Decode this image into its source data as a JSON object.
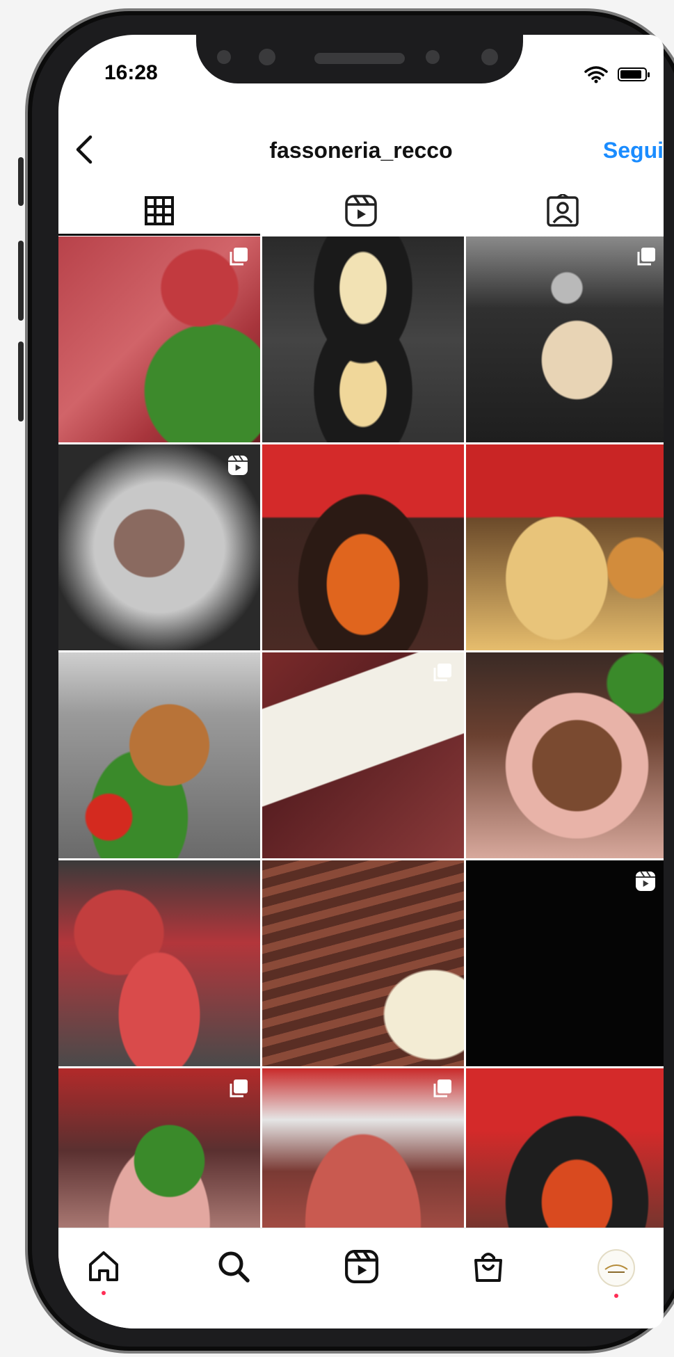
{
  "status_bar": {
    "time": "16:28"
  },
  "header": {
    "username": "fassoneria_recco",
    "follow_label": "Segui"
  },
  "tabs": [
    {
      "name": "posts",
      "icon": "grid-icon",
      "active": true
    },
    {
      "name": "reels",
      "icon": "reels-icon",
      "active": false
    },
    {
      "name": "tagged",
      "icon": "tagged-person-icon",
      "active": false
    }
  ],
  "grid": [
    {
      "subject": "raw beef tartare with arugula",
      "badge": "multi-post-icon"
    },
    {
      "subject": "spaghetti plated in black bowl",
      "badge": ""
    },
    {
      "subject": "sauce poured over meat",
      "badge": "multi-post-icon"
    },
    {
      "subject": "burger patty in pan",
      "badge": "reel-icon"
    },
    {
      "subject": "pasta with ragù in pan",
      "badge": ""
    },
    {
      "subject": "meat with potatoes and sauce",
      "badge": ""
    },
    {
      "subject": "grilled meat with tomatoes",
      "badge": ""
    },
    {
      "subject": "packaged meat",
      "badge": "multi-post-icon"
    },
    {
      "subject": "sliced roast beef",
      "badge": ""
    },
    {
      "subject": "raw hamburger patties",
      "badge": ""
    },
    {
      "subject": "grilled ribs platter",
      "badge": ""
    },
    {
      "subject": "black reel",
      "badge": "reel-icon"
    },
    {
      "subject": "cured meats with arugula",
      "badge": "multi-post-icon"
    },
    {
      "subject": "raw beef slices",
      "badge": "multi-post-icon"
    },
    {
      "subject": "pasta dish in restaurant",
      "badge": ""
    }
  ],
  "bottom_nav": [
    {
      "name": "home",
      "icon": "home-icon",
      "notification_dot": true
    },
    {
      "name": "search",
      "icon": "search-icon",
      "notification_dot": false
    },
    {
      "name": "reels",
      "icon": "reels-icon",
      "notification_dot": false
    },
    {
      "name": "shop",
      "icon": "shop-bag-icon",
      "notification_dot": false
    },
    {
      "name": "profile",
      "icon": "profile-avatar",
      "notification_dot": true
    }
  ],
  "colors": {
    "follow_blue": "#1a8cff",
    "notification_red": "#ff2d55"
  }
}
